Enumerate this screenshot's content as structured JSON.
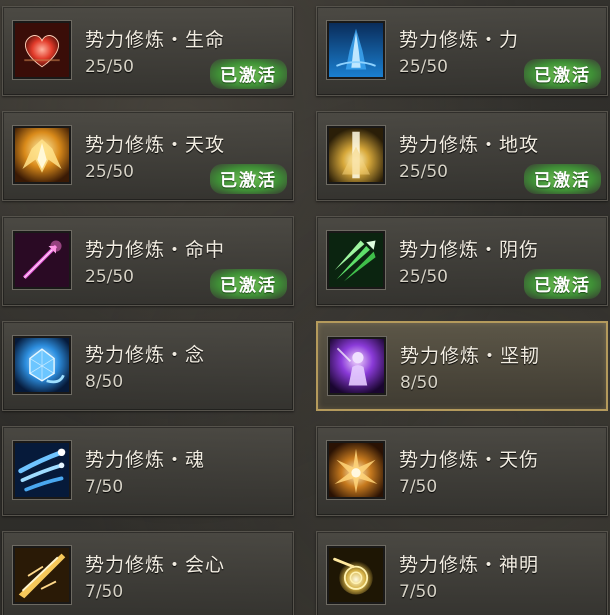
{
  "cards": [
    {
      "title": "势力修炼・生命",
      "level": "25/50",
      "badge": "已激活",
      "icon": "heart-icon",
      "active": true,
      "selected": false
    },
    {
      "title": "势力修炼・力",
      "level": "25/50",
      "badge": "已激活",
      "icon": "strength-icon",
      "active": true,
      "selected": false
    },
    {
      "title": "势力修炼・天攻",
      "level": "25/50",
      "badge": "已激活",
      "icon": "wings-icon",
      "active": true,
      "selected": false
    },
    {
      "title": "势力修炼・地攻",
      "level": "25/50",
      "badge": "已激活",
      "icon": "light-pillar-icon",
      "active": true,
      "selected": false
    },
    {
      "title": "势力修炼・命中",
      "level": "25/50",
      "badge": "已激活",
      "icon": "arrow-hit-icon",
      "active": true,
      "selected": false
    },
    {
      "title": "势力修炼・阴伤",
      "level": "25/50",
      "badge": "已激活",
      "icon": "green-blades-icon",
      "active": true,
      "selected": false
    },
    {
      "title": "势力修炼・念",
      "level": "8/50",
      "badge": "",
      "icon": "crystal-icon",
      "active": false,
      "selected": false
    },
    {
      "title": "势力修炼・坚韧",
      "level": "8/50",
      "badge": "",
      "icon": "spirit-figure-icon",
      "active": false,
      "selected": true
    },
    {
      "title": "势力修炼・魂",
      "level": "7/50",
      "badge": "",
      "icon": "soul-streaks-icon",
      "active": false,
      "selected": false
    },
    {
      "title": "势力修炼・天伤",
      "level": "7/50",
      "badge": "",
      "icon": "golden-burst-icon",
      "active": false,
      "selected": false
    },
    {
      "title": "势力修炼・会心",
      "level": "7/50",
      "badge": "",
      "icon": "golden-slash-icon",
      "active": false,
      "selected": false
    },
    {
      "title": "势力修炼・神明",
      "level": "7/50",
      "badge": "",
      "icon": "golden-orb-icon",
      "active": false,
      "selected": false
    }
  ]
}
